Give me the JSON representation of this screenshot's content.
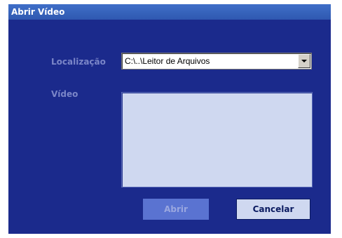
{
  "window": {
    "title": "Abrir Vídeo"
  },
  "form": {
    "location_label": "Localização",
    "location_value": "C:\\..\\Leitor de Arquivos",
    "video_label": "Vídeo"
  },
  "buttons": {
    "open_label": "Abrir",
    "open_state": "disabled",
    "cancel_label": "Cancelar"
  },
  "colors": {
    "window_background": "#1b2a8c",
    "titlebar": "#3f6fc8",
    "label_text": "#7b86c8",
    "listbox_background": "#cfd8f0"
  },
  "icons": {
    "dropdown": "chevron-down-icon"
  }
}
